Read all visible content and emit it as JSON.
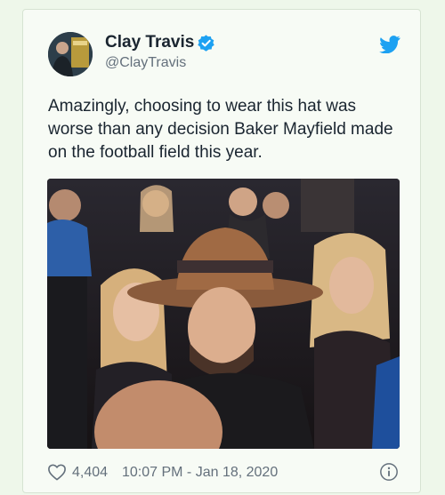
{
  "tweet": {
    "display_name": "Clay Travis",
    "handle": "@ClayTravis",
    "text": "Amazingly, choosing to wear this hat was worse than any decision Baker Mayfield made on the football field this year.",
    "likes": "4,404",
    "timestamp": "10:07 PM - Jan 18, 2020",
    "icons": {
      "verified": "verified-badge-icon",
      "brand": "twitter-bird-icon",
      "like": "heart-icon",
      "info": "info-icon"
    }
  },
  "colors": {
    "background": "#eef7ea",
    "card": "#f7fbf5",
    "text": "#1a2530",
    "secondary": "#64707c",
    "brand_blue": "#1da1f2"
  }
}
